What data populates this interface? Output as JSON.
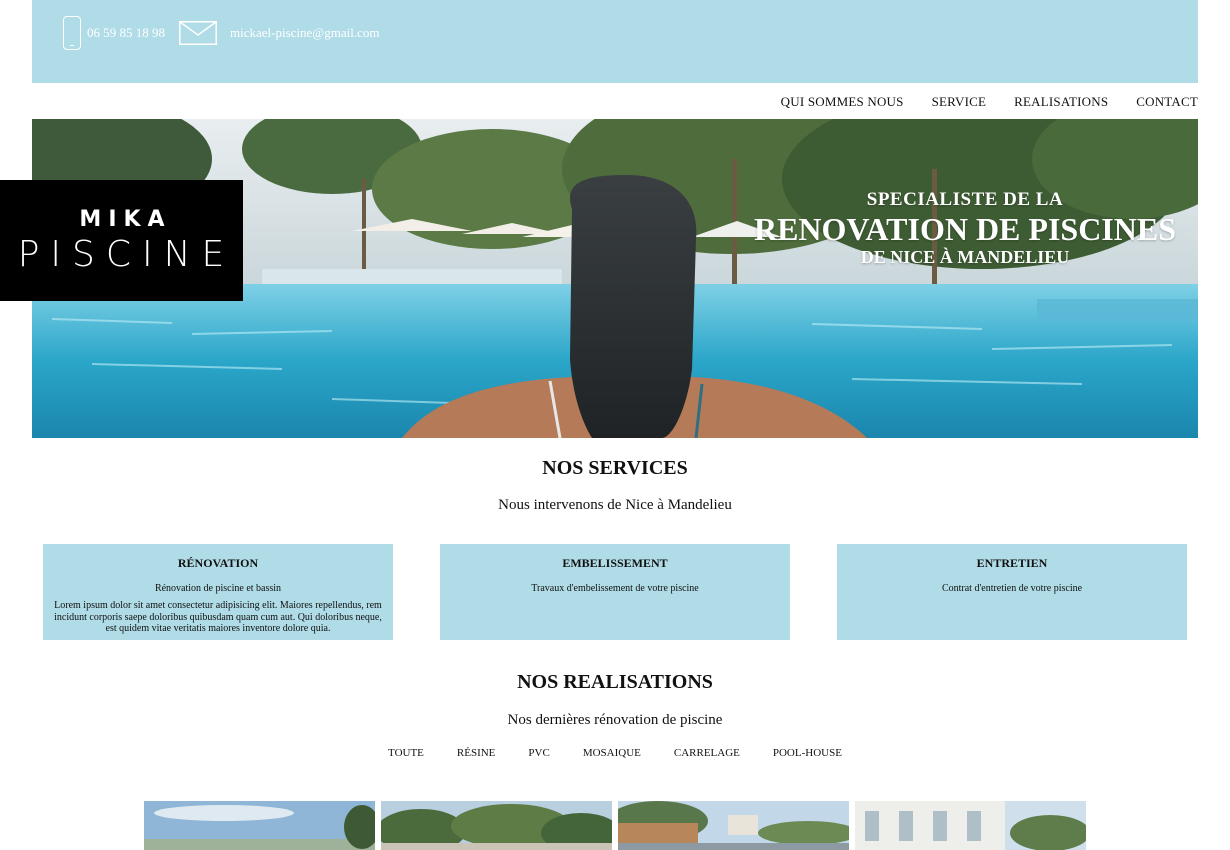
{
  "header": {
    "phone": "06 59 85 18 98",
    "email": "mickael-piscine@gmail.com",
    "icons": {
      "phone": "phone-icon",
      "email": "mail-icon"
    },
    "background_color": "#b0dce7"
  },
  "nav": {
    "items": [
      {
        "label": "QUI SOMMES NOUS"
      },
      {
        "label": "SERVICE"
      },
      {
        "label": "REALISATIONS"
      },
      {
        "label": "CONTACT"
      }
    ]
  },
  "logo": {
    "line1": "MIKA",
    "line2": "PISCINE"
  },
  "hero": {
    "line1": "SPECIALISTE DE LA",
    "line2": "RENOVATION DE PISCINES",
    "line3": "DE NICE À MANDELIEU"
  },
  "services": {
    "title": "NOS SERVICES",
    "subtitle": "Nous intervenons de Nice à Mandelieu",
    "cards": [
      {
        "title": "RÉNOVATION",
        "subtitle": "Rénovation de piscine et bassin",
        "text": "Lorem ipsum dolor sit amet consectetur adipisicing elit. Maiores repellendus, rem incidunt corporis saepe doloribus quibusdam quam cum aut. Qui doloribus neque, est quidem vitae veritatis maiores inventore dolore quia."
      },
      {
        "title": "EMBELISSEMENT",
        "subtitle": "Travaux d'embelissement de votre piscine",
        "text": ""
      },
      {
        "title": "ENTRETIEN",
        "subtitle": "Contrat d'entretien de votre piscine",
        "text": ""
      }
    ],
    "card_color": "#b0dce7"
  },
  "realisations": {
    "title": "NOS REALISATIONS",
    "subtitle": "Nos dernières rénovation de piscine",
    "filters": [
      "TOUTE",
      "RÉSINE",
      "PVC",
      "MOSAIQUE",
      "CARRELAGE",
      "POOL-HOUSE"
    ]
  }
}
